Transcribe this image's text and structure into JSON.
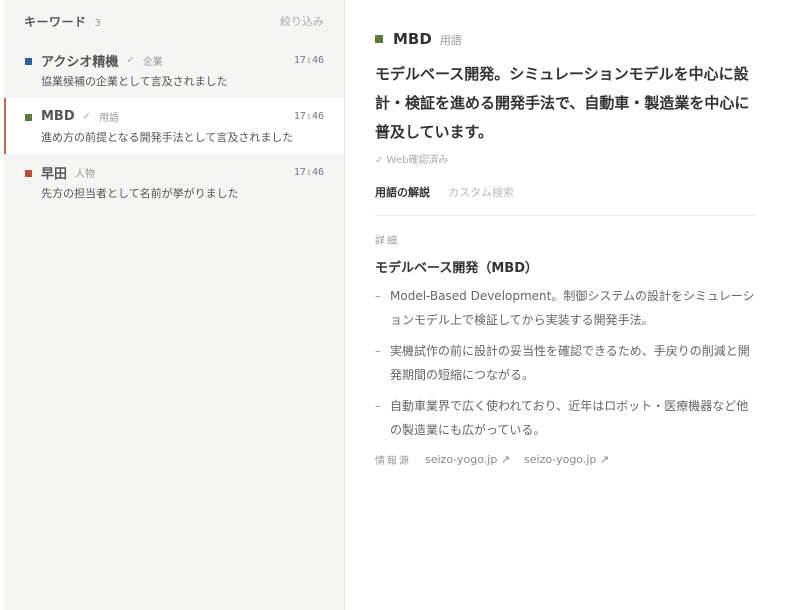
{
  "sidebar": {
    "title": "キーワード",
    "count": "3",
    "filter_label": "絞り込み",
    "items": [
      {
        "name": "アクシオ精機",
        "check": "✓",
        "type": "企業",
        "time": "17:46",
        "desc": "協業候補の企業として言及されました",
        "color": "#2e5f9e"
      },
      {
        "name": "MBD",
        "check": "✓",
        "type": "用語",
        "time": "17:46",
        "desc": "進め方の前提となる開発手法として言及されました",
        "color": "#5d7a3a"
      },
      {
        "name": "早田",
        "check": "",
        "type": "人物",
        "time": "17:46",
        "desc": "先方の担当者として名前が挙がりました",
        "color": "#b5533a"
      }
    ]
  },
  "main": {
    "name": "MBD",
    "type": "用語",
    "color": "#5d7a3a",
    "definition": "モデルベース開発。シミュレーションモデルを中心に設計・検証を進める開発手法で、自動車・製造業を中心に普及しています。",
    "verified": "✓ Web確認済み",
    "tabs": [
      "用語の解説",
      "カスタム検索"
    ],
    "section_label": "詳細",
    "detail_title": "モデルベース開発（MBD）",
    "bullets": [
      "Model-Based Development。制御システムの設計をシミュレーションモデル上で検証してから実装する開発手法。",
      "実機試作の前に設計の妥当性を確認できるため、手戻りの削減と開発期間の短縮につながる。",
      "自動車業界で広く使われており、近年はロボット・医療機器など他の製造業にも広がっている。"
    ],
    "sources_label": "情報源",
    "sources": [
      "seizo-yogo.jp ↗",
      "seizo-yogo.jp ↗"
    ]
  }
}
